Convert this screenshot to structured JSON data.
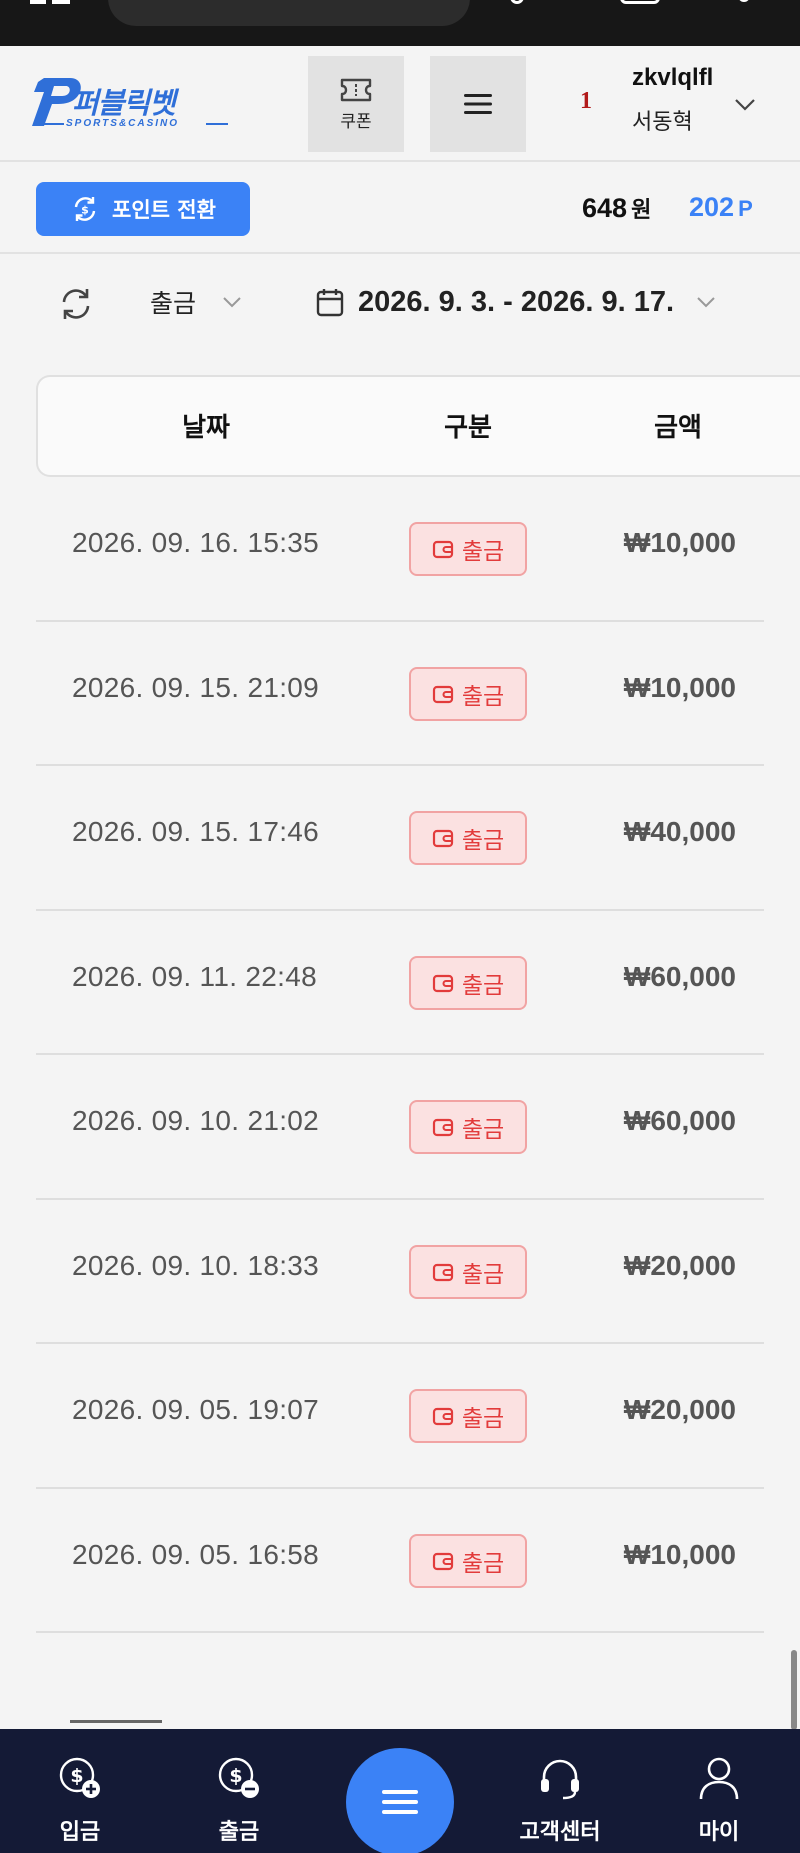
{
  "header": {
    "logo_text": "퍼블릭벳",
    "logo_sub": "SPORTS&CASINO",
    "coupon_label": "쿠폰",
    "user": {
      "level": "1",
      "id": "zkvlqlfl",
      "name": "서동혁"
    }
  },
  "subbar": {
    "convert_label": "포인트 전환",
    "money_value": "648",
    "money_unit": "원",
    "points_value": "202",
    "points_unit": "P"
  },
  "filters": {
    "type_selected": "출금",
    "date_range": "2026. 9. 3. - 2026. 9. 17."
  },
  "table": {
    "headers": {
      "date": "날짜",
      "type": "구분",
      "amount": "금액"
    },
    "rows": [
      {
        "date": "2026. 09. 16. 15:35",
        "type": "출금",
        "amount": "₩10,000"
      },
      {
        "date": "2026. 09. 15. 21:09",
        "type": "출금",
        "amount": "₩10,000"
      },
      {
        "date": "2026. 09. 15. 17:46",
        "type": "출금",
        "amount": "₩40,000"
      },
      {
        "date": "2026. 09. 11. 22:48",
        "type": "출금",
        "amount": "₩60,000"
      },
      {
        "date": "2026. 09. 10. 21:02",
        "type": "출금",
        "amount": "₩60,000"
      },
      {
        "date": "2026. 09. 10. 18:33",
        "type": "출금",
        "amount": "₩20,000"
      },
      {
        "date": "2026. 09. 05. 19:07",
        "type": "출금",
        "amount": "₩20,000"
      },
      {
        "date": "2026. 09. 05. 16:58",
        "type": "출금",
        "amount": "₩10,000"
      }
    ]
  },
  "bottom_nav": {
    "deposit": "입금",
    "withdraw": "출금",
    "support": "고객센터",
    "my": "마이"
  },
  "colors": {
    "accent": "#3b82f6",
    "nav_bg": "#141a36",
    "badge_red": "#e23b3b",
    "logo_blue": "#2f6fd8"
  },
  "icons": {
    "coupon": "ticket-icon",
    "menu": "hamburger-icon",
    "convert": "exchange-icon",
    "refresh": "refresh-icon",
    "calendar": "calendar-icon",
    "badge": "wallet-icon"
  }
}
